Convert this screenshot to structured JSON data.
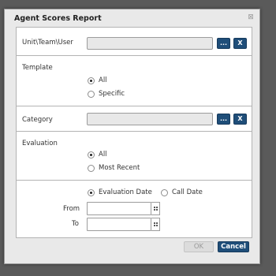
{
  "dialog": {
    "title": "Agent Scores Report",
    "close_icon": "close-icon"
  },
  "unit": {
    "label": "Unit\\Team\\User",
    "value": "",
    "browse_label": "...",
    "clear_label": "X"
  },
  "template": {
    "label": "Template",
    "options": [
      {
        "label": "All",
        "checked": true
      },
      {
        "label": "Specific",
        "checked": false
      }
    ]
  },
  "category": {
    "label": "Category",
    "value": "",
    "browse_label": "...",
    "clear_label": "X"
  },
  "evaluation": {
    "label": "Evaluation",
    "options": [
      {
        "label": "All",
        "checked": true
      },
      {
        "label": "Most Recent",
        "checked": false
      }
    ]
  },
  "dates": {
    "type_options": [
      {
        "label": "Evaluation Date",
        "checked": true
      },
      {
        "label": "Call Date",
        "checked": false
      }
    ],
    "from_label": "From",
    "to_label": "To",
    "from_value": "",
    "to_value": "",
    "calendar_icon": "calendar-icon"
  },
  "footer": {
    "ok_label": "OK",
    "cancel_label": "Cancel"
  },
  "colors": {
    "accent": "#1f4e79",
    "background": "#5a5a5a",
    "dialog": "#e9e9e9",
    "disabled": "#dcdcdc"
  }
}
